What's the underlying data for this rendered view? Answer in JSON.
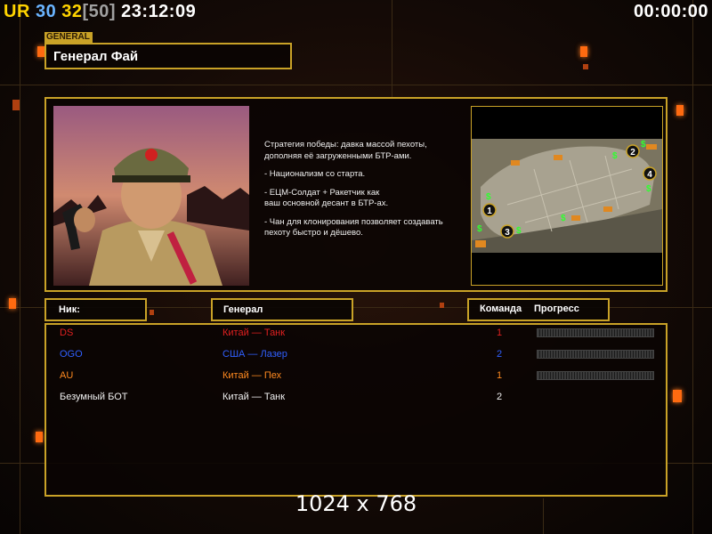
{
  "hud": {
    "ur": "UR",
    "num1": "30",
    "num2": "32",
    "cap": "[50]",
    "clock": "23:12:09",
    "timer": "00:00:00"
  },
  "general": {
    "tag": "GENERAL",
    "name": "Генерал Фай",
    "description": [
      "Стратегия победы: давка массой пехоты,\n дополняя её загруженными БТР-ами.",
      "- Национализм со старта.",
      "- ЕЦМ-Солдат + Ракетчик как\nваш основной десант в БТР-ах.",
      "- Чан для клонирования позволяет создавать\n пехоту быстро и дёшево."
    ]
  },
  "map": {
    "start_positions": [
      "1",
      "2",
      "3",
      "4"
    ],
    "cash_icon": "$"
  },
  "table": {
    "headers": {
      "nick": "Ник:",
      "general": "Генерал",
      "team": "Команда",
      "progress": "Прогресс"
    },
    "rows": [
      {
        "nick": "DS",
        "general": "Китай — Танк",
        "team": "1",
        "color": "#e02020",
        "progress": 0.0,
        "show_bar": true
      },
      {
        "nick": "OGO",
        "general": "США — Лазер",
        "team": "2",
        "color": "#3060ff",
        "progress": 0.0,
        "show_bar": true
      },
      {
        "nick": "AU",
        "general": "Китай — Пех",
        "team": "1",
        "color": "#ff8a20",
        "progress": 0.0,
        "show_bar": true
      },
      {
        "nick": "Безумный БОТ",
        "general": "Китай — Танк",
        "team": "2",
        "color": "#f0f0f0",
        "progress": 0.0,
        "show_bar": false
      }
    ]
  },
  "resolution": "1024 x 768",
  "colors": {
    "frame": "#c9a227",
    "glow": "#ff6a10"
  }
}
